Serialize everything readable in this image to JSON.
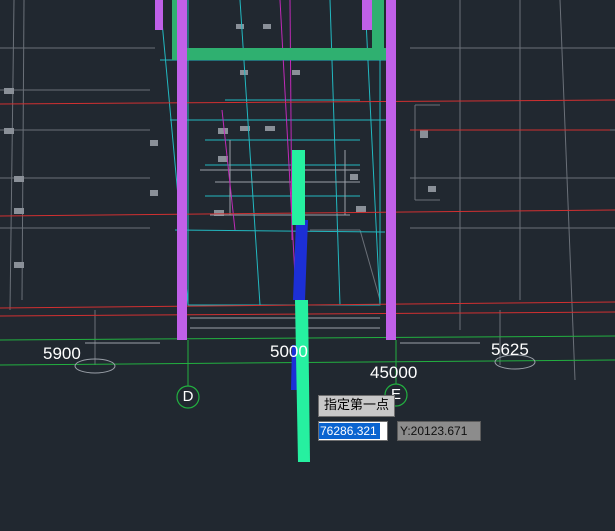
{
  "drawing": {
    "dimensions": {
      "left": "5900",
      "center": "5000",
      "total": "45000",
      "right": "5625"
    },
    "axes": {
      "left": "D",
      "right": "E"
    }
  },
  "command": {
    "prompt": "指定第一点",
    "x_value": "76286.321",
    "y_value": "Y:20123.671"
  },
  "colors": {
    "background": "#212830",
    "column": "#c060e8",
    "beam": "#2fd07a",
    "highlight_beam": "#26f0a0",
    "blue_member": "#1c2fd6",
    "axis_line": "#d03030",
    "grid_line": "#22b040"
  }
}
